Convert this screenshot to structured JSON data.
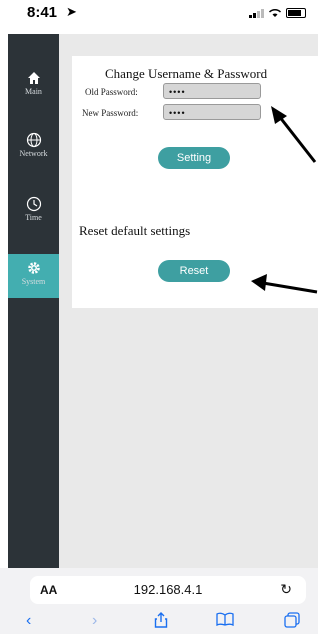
{
  "status_bar": {
    "time": "8:41"
  },
  "sidebar": {
    "items": [
      {
        "label": "Main",
        "icon": "home-icon",
        "active": false
      },
      {
        "label": "Network",
        "icon": "globe-icon",
        "active": false
      },
      {
        "label": "Time",
        "icon": "clock-icon",
        "active": false
      },
      {
        "label": "System",
        "icon": "gear-icon",
        "active": true
      }
    ]
  },
  "password_card": {
    "title": "Change Username & Password",
    "old_label": "Old Password:",
    "old_value": "••••",
    "new_label": "New Password:",
    "new_value": "••••",
    "button": "Setting"
  },
  "reset_card": {
    "title": "Reset default settings",
    "button": "Reset"
  },
  "browser": {
    "aa_label": "AA",
    "url": "192.168.4.1"
  },
  "colors": {
    "sidebar": "#2c3338",
    "accent": "#43aeb0",
    "button": "#3e9fa1"
  }
}
